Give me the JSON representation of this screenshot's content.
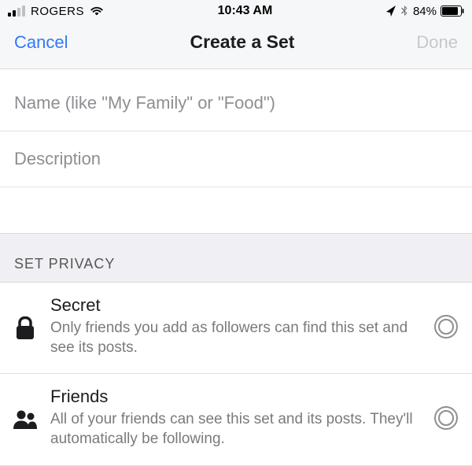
{
  "status_bar": {
    "carrier": "ROGERS",
    "time": "10:43 AM",
    "battery_pct": "84%"
  },
  "nav": {
    "cancel": "Cancel",
    "title": "Create a Set",
    "done": "Done"
  },
  "inputs": {
    "name_placeholder": "Name (like \"My Family\" or \"Food\")",
    "description_placeholder": "Description"
  },
  "section": {
    "privacy_header": "SET PRIVACY"
  },
  "options": {
    "secret": {
      "title": "Secret",
      "desc": "Only friends you add as followers can find this set and see its posts."
    },
    "friends": {
      "title": "Friends",
      "desc": "All of your friends can see this set and its posts. They'll automatically be following."
    }
  }
}
